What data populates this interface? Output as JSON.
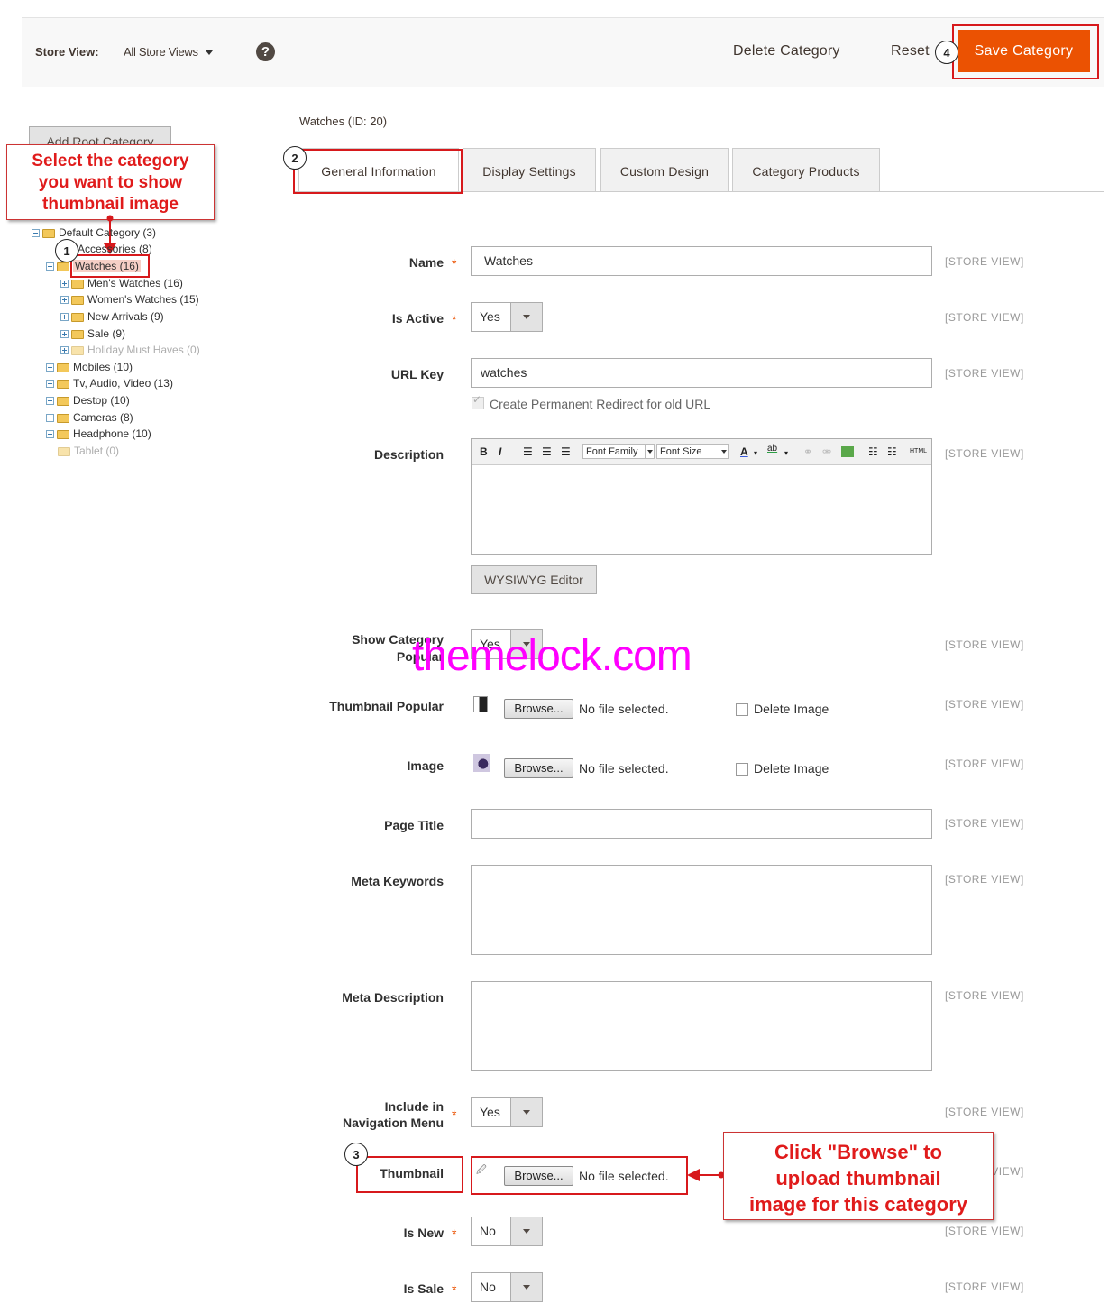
{
  "header": {
    "store_view_label": "Store View:",
    "store_view_value": "All Store Views",
    "help_icon": "?",
    "delete": "Delete Category",
    "reset": "Reset",
    "save": "Save Category"
  },
  "sidebar": {
    "add_root": "Add Root Category",
    "tree": [
      {
        "label": "Default Category (3)",
        "level": 0,
        "toggle": "minus"
      },
      {
        "label": "Accessories (8)",
        "level": 1,
        "toggle": "none"
      },
      {
        "label": "Watches (16)",
        "level": 1,
        "toggle": "minus",
        "selected": true
      },
      {
        "label": "Men's Watches (16)",
        "level": 2,
        "toggle": "plus"
      },
      {
        "label": "Women's Watches (15)",
        "level": 2,
        "toggle": "plus"
      },
      {
        "label": "New Arrivals (9)",
        "level": 2,
        "toggle": "plus"
      },
      {
        "label": "Sale (9)",
        "level": 2,
        "toggle": "plus"
      },
      {
        "label": "Holiday Must Haves (0)",
        "level": 2,
        "toggle": "plus",
        "disabled": true
      },
      {
        "label": "Mobiles (10)",
        "level": 1,
        "toggle": "plus"
      },
      {
        "label": "Tv, Audio, Video (13)",
        "level": 1,
        "toggle": "plus"
      },
      {
        "label": "Destop (10)",
        "level": 1,
        "toggle": "plus"
      },
      {
        "label": "Cameras (8)",
        "level": 1,
        "toggle": "plus"
      },
      {
        "label": "Headphone (10)",
        "level": 1,
        "toggle": "plus"
      },
      {
        "label": "Tablet (0)",
        "level": 1,
        "toggle": "none",
        "disabled": true
      }
    ]
  },
  "annotations": {
    "step1": "1",
    "step2": "2",
    "step3": "3",
    "step4": "4",
    "callout_select_lines": [
      "Select the category",
      "you want to show",
      "thumbnail image"
    ],
    "callout_browse_lines": [
      "Click \"Browse\" to",
      "upload thumbnail",
      "image for this category"
    ],
    "watermark": "themelock.com"
  },
  "main": {
    "crumb": "Watches (ID: 20)",
    "tabs": [
      "General Information",
      "Display Settings",
      "Custom Design",
      "Category Products"
    ],
    "scope": "[STORE VIEW]",
    "name_label": "Name",
    "name_value": "Watches",
    "is_active_label": "Is Active",
    "is_active_value": "Yes",
    "url_key_label": "URL Key",
    "url_key_value": "watches",
    "redirect_label": "Create Permanent Redirect for old URL",
    "description_label": "Description",
    "font_family": "Font Family",
    "font_size": "Font Size",
    "html_btn": "HTML",
    "wysiwyg": "WYSIWYG Editor",
    "show_popular_label_1": "Show Category",
    "show_popular_label_2": "Popular",
    "show_popular_value": "Yes",
    "thumb_popular_label": "Thumbnail Popular",
    "browse": "Browse...",
    "no_file": "No file selected.",
    "delete_image": "Delete Image",
    "image_label": "Image",
    "page_title_label": "Page Title",
    "meta_keywords_label": "Meta Keywords",
    "meta_description_label": "Meta Description",
    "include_nav_label_1": "Include in",
    "include_nav_label_2": "Navigation Menu",
    "include_nav_value": "Yes",
    "thumbnail_label": "Thumbnail",
    "is_new_label": "Is New",
    "is_new_value": "No",
    "is_sale_label": "Is Sale",
    "is_sale_value": "No"
  },
  "colors": {
    "accent": "#eb5202",
    "annotation_red": "#d7191c",
    "watermark": "#ff00ff"
  }
}
